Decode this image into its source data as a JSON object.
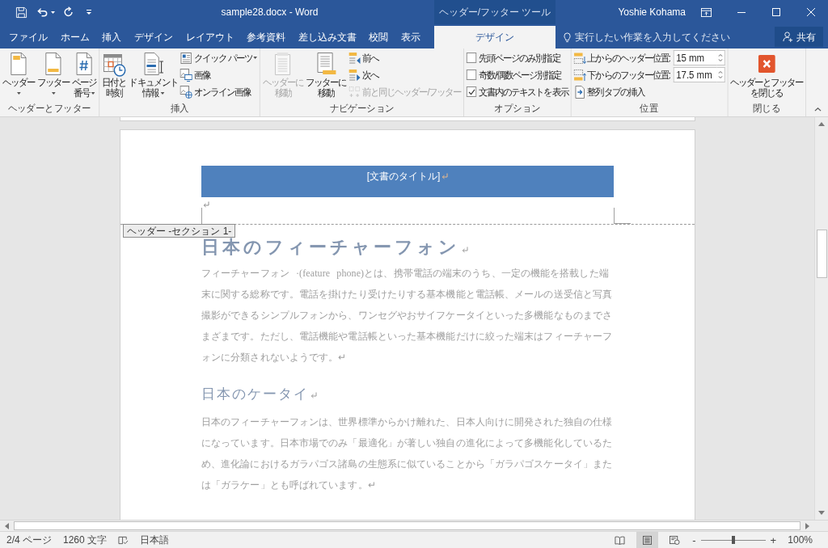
{
  "window": {
    "title": "sample28.docx - Word",
    "user": "Yoshie Kohama"
  },
  "tabs": [
    {
      "label": "ファイル",
      "selected": false
    },
    {
      "label": "ホーム",
      "selected": false
    },
    {
      "label": "挿入",
      "selected": false
    },
    {
      "label": "デザイン",
      "selected": false
    },
    {
      "label": "レイアウト",
      "selected": false
    },
    {
      "label": "参考資料",
      "selected": false
    },
    {
      "label": "差し込み文書",
      "selected": false
    },
    {
      "label": "校閲",
      "selected": false
    },
    {
      "label": "表示",
      "selected": false
    }
  ],
  "contextual": {
    "label": "ヘッダー/フッター ツール",
    "tabs": [
      {
        "label": "デザイン",
        "selected": true
      }
    ]
  },
  "tell_me": {
    "placeholder": "実行したい作業を入力してください"
  },
  "share": {
    "label": "共有"
  },
  "ribbon": [
    {
      "label": "ヘッダーとフッター",
      "items": [
        {
          "kind": "large",
          "lines": [
            "ヘッダー"
          ],
          "dropdown": true,
          "disabled": false
        },
        {
          "kind": "large",
          "lines": [
            "フッター"
          ],
          "dropdown": true,
          "disabled": false
        },
        {
          "kind": "large",
          "lines": [
            "ページ",
            "番号"
          ],
          "dropdown": true,
          "disabled": false
        }
      ]
    },
    {
      "label": "挿入",
      "items": [
        {
          "kind": "large",
          "lines": [
            "日付と",
            "時刻"
          ],
          "dropdown": false,
          "disabled": false
        },
        {
          "kind": "large",
          "lines": [
            "ドキュメント",
            "情報"
          ],
          "dropdown": true,
          "disabled": false
        },
        {
          "kind": "small",
          "label": "クイック パーツ",
          "dropdown": true,
          "disabled": false
        },
        {
          "kind": "small",
          "label": "画像",
          "dropdown": false,
          "disabled": false
        },
        {
          "kind": "small",
          "label": "オンライン画像",
          "dropdown": false,
          "disabled": false
        }
      ]
    },
    {
      "label": "ナビゲーション",
      "items": [
        {
          "kind": "large",
          "lines": [
            "ヘッダーに",
            "移動"
          ],
          "dropdown": false,
          "disabled": true
        },
        {
          "kind": "large",
          "lines": [
            "フッターに",
            "移動"
          ],
          "dropdown": false,
          "disabled": false
        },
        {
          "kind": "small",
          "label": "前へ",
          "dropdown": false,
          "disabled": false
        },
        {
          "kind": "small",
          "label": "次へ",
          "dropdown": false,
          "disabled": false
        },
        {
          "kind": "small",
          "label": "前と同じヘッダー/フッター",
          "dropdown": false,
          "disabled": true
        }
      ]
    },
    {
      "label": "オプション",
      "items": [
        {
          "kind": "checkbox",
          "label": "先頭ページのみ別指定",
          "checked": false,
          "disabled": false
        },
        {
          "kind": "checkbox",
          "label": "奇数/偶数ページ別指定",
          "checked": false,
          "disabled": false
        },
        {
          "kind": "checkbox",
          "label": "文書内のテキストを表示",
          "checked": true,
          "disabled": false
        }
      ]
    },
    {
      "label": "位置",
      "items": [
        {
          "kind": "spinner",
          "label": "上からのヘッダー位置:",
          "value": "15 mm",
          "disabled": false
        },
        {
          "kind": "spinner",
          "label": "下からのフッター位置:",
          "value": "17.5 mm",
          "disabled": false
        },
        {
          "kind": "small",
          "label": "整列タブの挿入",
          "dropdown": false,
          "disabled": false
        }
      ]
    },
    {
      "label": "閉じる",
      "items": [
        {
          "kind": "large",
          "lines": [
            "ヘッダーとフッター",
            "を閉じる"
          ],
          "dropdown": false,
          "disabled": false
        }
      ]
    }
  ],
  "document": {
    "header": {
      "title": "[文書のタイトル]",
      "tag": "ヘッダー -セクション 1-"
    },
    "blocks": [
      {
        "kind": "title",
        "text": "日本のフィーチャーフォン"
      },
      {
        "kind": "paragraph",
        "text": "フィーチャーフォン ·(feature phone)とは、携帯電話の端末のうち、一定の機能を搭載した端末に関する総称です。電話を掛けたり受けたりする基本機能と電話帳、メールの送受信と写真撮影ができるシンプルフォンから、ワンセグやおサイフケータイといった多機能なものまでさまざまです。ただし、電話機能や電話帳といった基本機能だけに絞った端末はフィーチャーフォンに分類されないようです。↵"
      },
      {
        "kind": "heading",
        "text": "日本のケータイ"
      },
      {
        "kind": "paragraph",
        "text": "日本のフィーチャーフォンは、世界標準からかけ離れた、日本人向けに開発された独自の仕様になっています。日本市場でのみ「最適化」が著しい独自の進化によって多機能化しているため、進化論におけるガラパゴス諸島の生態系に似ていることから「ガラパゴスケータイ」または「ガラケー」とも呼ばれています。↵"
      }
    ]
  },
  "status_bar": {
    "page": "2/4 ページ",
    "word_count": "1260 文字",
    "language": "日本語",
    "views": [
      {
        "selected": false
      },
      {
        "selected": true
      },
      {
        "selected": false
      }
    ],
    "zoom_out": "-",
    "zoom_in": "+",
    "zoom": {
      "level": 0.5,
      "reading": "100%"
    }
  }
}
